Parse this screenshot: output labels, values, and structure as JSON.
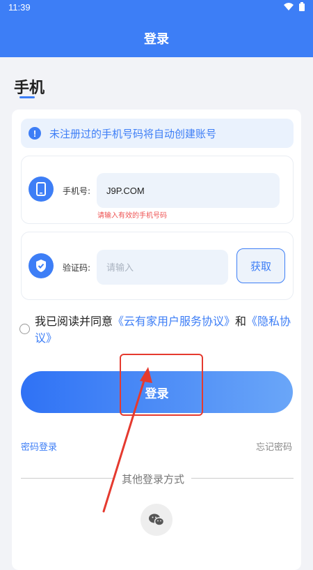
{
  "status_bar": {
    "time": "11:39"
  },
  "header": {
    "title": "登录"
  },
  "page": {
    "title": "手机"
  },
  "notice": {
    "icon": "info-icon",
    "text": "未注册过的手机号码将自动创建账号"
  },
  "phone_field": {
    "icon": "phone-icon",
    "label": "手机号:",
    "value": "J9P.COM",
    "error": "请输入有效的手机号码"
  },
  "code_field": {
    "icon": "shield-check-icon",
    "label": "验证码:",
    "placeholder": "请输入",
    "get_button": "获取"
  },
  "agreement": {
    "prefix": "我已阅读并同意",
    "terms_link": "《云有家用户服务协议》",
    "and": "和",
    "privacy_link": "《隐私协议》"
  },
  "login_button": "登录",
  "links": {
    "password_login": "密码登录",
    "forgot_password": "忘记密码"
  },
  "other_login": {
    "label": "其他登录方式",
    "wechat_icon": "wechat-icon"
  },
  "colors": {
    "primary": "#3d7ef6",
    "error": "#ee5252",
    "annotation": "#e53a2f"
  }
}
